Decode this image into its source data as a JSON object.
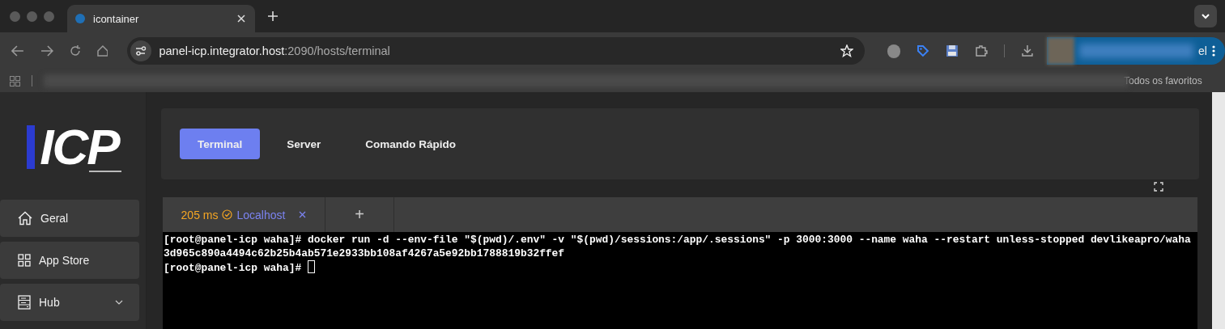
{
  "browser": {
    "tab_title": "icontainer",
    "url_host": "panel-icp.integrator.host",
    "url_rest": ":2090/hosts/terminal",
    "profile_text": "el",
    "bookmarks_all": "Todos os favoritos"
  },
  "logo": {
    "mark": "ICP"
  },
  "sidebar": {
    "items": [
      {
        "label": "Geral",
        "kind": "home",
        "expandable": false
      },
      {
        "label": "App Store",
        "kind": "grid",
        "expandable": false
      },
      {
        "label": "Hub",
        "kind": "server",
        "expandable": true
      }
    ]
  },
  "tabs": [
    {
      "label": "Terminal",
      "selected": true
    },
    {
      "label": "Server",
      "selected": false
    },
    {
      "label": "Comando Rápido",
      "selected": false
    }
  ],
  "sessions": [
    {
      "latency": "205 ms",
      "name": "Localhost",
      "connected": true
    }
  ],
  "add_session": "+",
  "terminal": {
    "lines": [
      "[root@panel-icp waha]# docker run -d --env-file \"$(pwd)/.env\" -v \"$(pwd)/sessions:/app/.sessions\" -p 3000:3000 --name waha --restart unless-stopped devlikeapro/waha",
      "3d965c890a4494c62b25b4ab571e2933bb108af4267a5e92bb1788819b32ffef",
      "[root@panel-icp waha]# "
    ],
    "cursor": true
  }
}
